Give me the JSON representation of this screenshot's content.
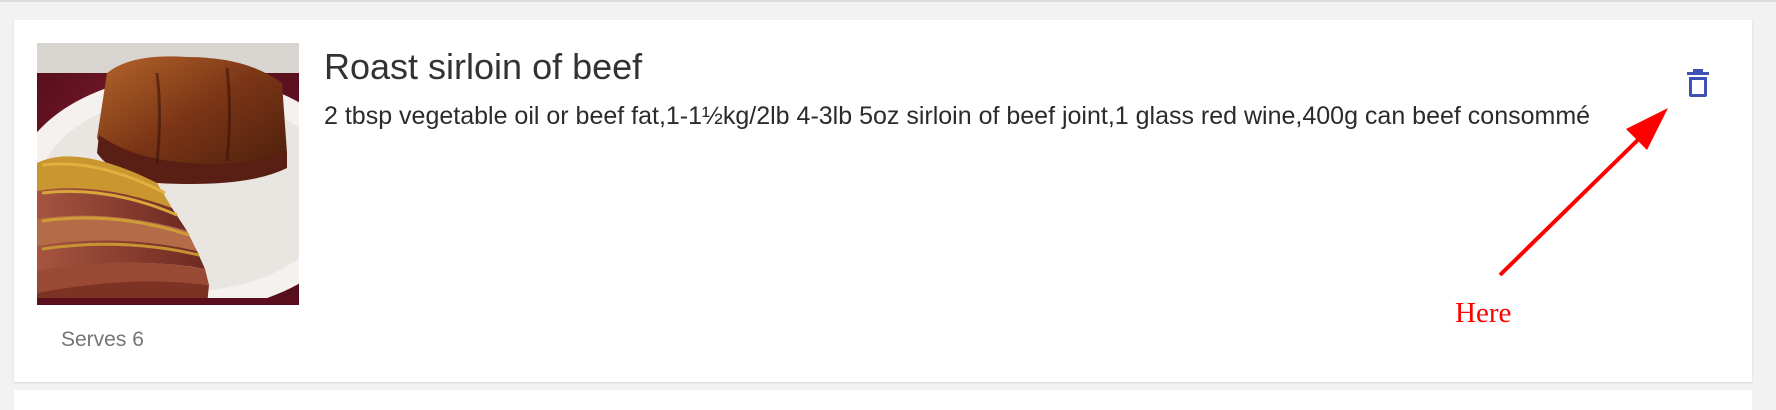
{
  "recipe": {
    "title": "Roast sirloin of beef",
    "ingredients": "2 tbsp vegetable oil or beef fat,1-1½kg/2lb 4-3lb 5oz sirloin of beef joint,1 glass red wine,400g can beef consommé",
    "serves": "Serves 6",
    "image_icon": "roast-beef-photo"
  },
  "actions": {
    "delete_icon": "trash-icon",
    "delete_color": "#3f51b5"
  },
  "annotation": {
    "label": "Here",
    "color": "#ff0000"
  }
}
